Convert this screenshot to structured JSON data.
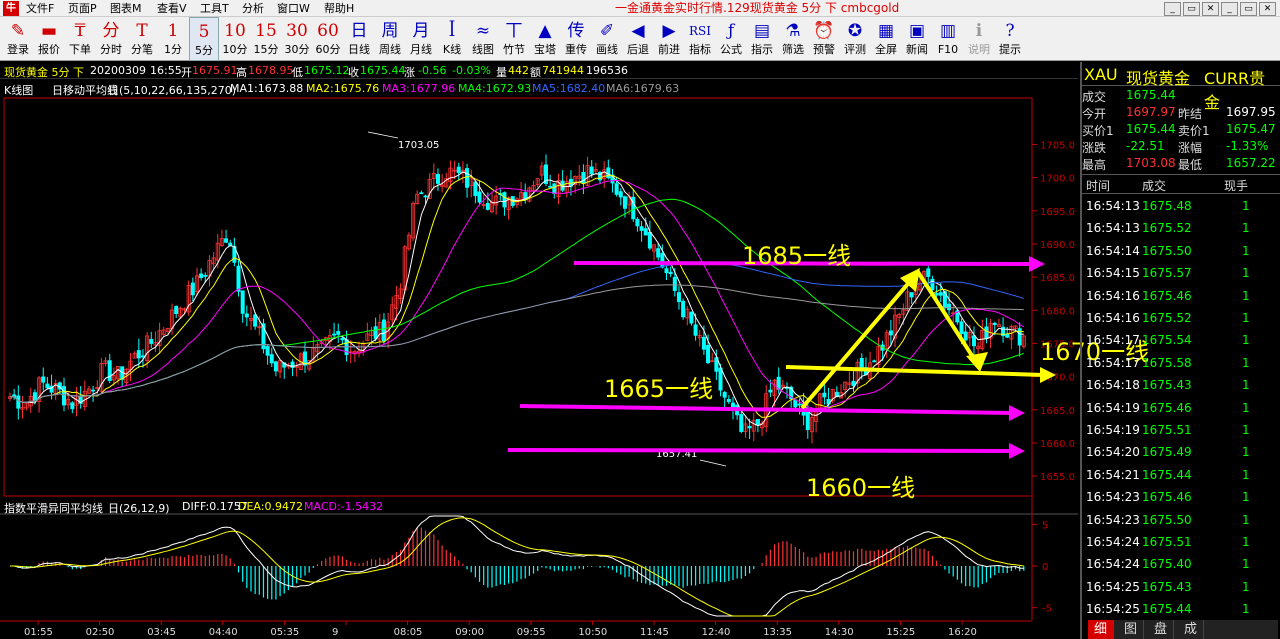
{
  "app": {
    "logo": "牛",
    "window_title": "一金通黄金实时行情.129现货黄金 5分 下 cmbcgold",
    "menus": [
      "文件F",
      "页面P",
      "图表M",
      "查看V",
      "工具T",
      "分析",
      "窗口W",
      "帮助H"
    ],
    "window_buttons": [
      "_",
      "▭",
      "✕",
      "_",
      "▭",
      "✕"
    ]
  },
  "toolbar": [
    {
      "glyph": "✎",
      "label": "登录",
      "color": "red"
    },
    {
      "glyph": "▬",
      "label": "报价",
      "color": "red"
    },
    {
      "glyph": "₸",
      "label": "下单",
      "color": "red"
    },
    {
      "glyph": "分",
      "label": "分时",
      "color": "red"
    },
    {
      "glyph": "T",
      "label": "分笔",
      "color": "red"
    },
    {
      "glyph": "1",
      "label": "1分",
      "color": "red"
    },
    {
      "glyph": "5",
      "label": "5分",
      "color": "red"
    },
    {
      "glyph": "10",
      "label": "10分",
      "color": "red"
    },
    {
      "glyph": "15",
      "label": "15分",
      "color": "red"
    },
    {
      "glyph": "30",
      "label": "30分",
      "color": "red"
    },
    {
      "glyph": "60",
      "label": "60分",
      "color": "red"
    },
    {
      "glyph": "日",
      "label": "日线",
      "color": "blue"
    },
    {
      "glyph": "周",
      "label": "周线",
      "color": "blue"
    },
    {
      "glyph": "月",
      "label": "月线",
      "color": "blue"
    },
    {
      "glyph": "ꟾ",
      "label": "K线",
      "color": "blue"
    },
    {
      "glyph": "≈",
      "label": "线图",
      "color": "blue"
    },
    {
      "glyph": "丅",
      "label": "竹节",
      "color": "blue"
    },
    {
      "glyph": "▲",
      "label": "宝塔",
      "color": "blue"
    },
    {
      "glyph": "传",
      "label": "重传",
      "color": "blue"
    },
    {
      "glyph": "✐",
      "label": "画线",
      "color": "blue"
    },
    {
      "glyph": "◀",
      "label": "后退",
      "color": "blue"
    },
    {
      "glyph": "▶",
      "label": "前进",
      "color": "blue"
    },
    {
      "glyph": "RSI",
      "label": "指标",
      "color": "blue"
    },
    {
      "glyph": "ƒ",
      "label": "公式",
      "color": "blue"
    },
    {
      "glyph": "▤",
      "label": "指示",
      "color": "blue"
    },
    {
      "glyph": "⚗",
      "label": "筛选",
      "color": "blue"
    },
    {
      "glyph": "⏰",
      "label": "预警",
      "color": "blue"
    },
    {
      "glyph": "✪",
      "label": "评测",
      "color": "blue"
    },
    {
      "glyph": "▦",
      "label": "全屏",
      "color": "blue"
    },
    {
      "glyph": "▣",
      "label": "新闻",
      "color": "blue"
    },
    {
      "glyph": "▥",
      "label": "F10",
      "color": "blue"
    },
    {
      "glyph": "ℹ",
      "label": "说明",
      "color": "grey"
    },
    {
      "glyph": "?",
      "label": "提示",
      "color": "blue"
    }
  ],
  "toolbar_selected": 6,
  "info": {
    "name": "现货黄金 5分 下",
    "date": "20200309",
    "time": "16:55",
    "open_label": "开",
    "open": "1675.91",
    "high_label": "高",
    "high": "1678.95",
    "low_label": "低",
    "low": "1675.12",
    "close_label": "收",
    "close": "1675.44",
    "chg_label": "涨",
    "chg": "-0.56",
    "chg_pct": "-0.03%",
    "vol_label": "量",
    "vol": "442",
    "amt_label": "额",
    "amt": "741944",
    "extra": "196536"
  },
  "ma": {
    "title": "K线图",
    "ind": "日移动平均线",
    "params": "日(5,10,22,66,135,270)",
    "lines": [
      {
        "label": "MA1:1673.88",
        "color": "#ffffff"
      },
      {
        "label": "MA2:1675.76",
        "color": "#ffff00"
      },
      {
        "label": "MA3:1677.96",
        "color": "#ff00ff"
      },
      {
        "label": "MA4:1672.93",
        "color": "#00ff00"
      },
      {
        "label": "MA5:1682.40",
        "color": "#3366ff"
      },
      {
        "label": "MA6:1679.63",
        "color": "#999999"
      }
    ]
  },
  "macd": {
    "name": "指数平滑异同平均线",
    "params": "日(26,12,9)",
    "diff": "DIFF:0.1757",
    "dea": "DEA:0.9472",
    "macd": "MACD:-1.5432"
  },
  "annotations": {
    "l1685": "1685一线",
    "l1670": "1670一线",
    "l1665": "1665一线",
    "l1660": "1660一线",
    "high_tag": "1703.05",
    "low_tag": "1657.41"
  },
  "time_axis": [
    "01:55",
    "02:50",
    "03:45",
    "04:40",
    "05:35",
    "9",
    "08:05",
    "09:00",
    "09:55",
    "10:50",
    "11:45",
    "12:40",
    "13:35",
    "14:30",
    "15:25",
    "16:20"
  ],
  "colors": {
    "up": "#ff3232",
    "down": "#00ffff",
    "axis": "#c00000",
    "magenta": "#ff00ff",
    "yellow": "#ffff00"
  },
  "chart_data": [
    {
      "type": "candlestick",
      "ylim": [
        1652,
        1712
      ],
      "yticks": [
        "1705.0",
        "1700.0",
        "1695.0",
        "1690.0",
        "1685.0",
        "1680.0",
        "1675.0",
        "1670.0",
        "1665.0",
        "1660.0",
        "1655.0"
      ],
      "close_path": [
        1667,
        1666,
        1669,
        1668,
        1666,
        1668,
        1671,
        1670,
        1673,
        1675,
        1678,
        1681,
        1684,
        1688,
        1692,
        1680,
        1676,
        1671,
        1672,
        1673,
        1674,
        1676,
        1674,
        1676,
        1677,
        1684,
        1697,
        1699,
        1701,
        1700,
        1698,
        1696,
        1697,
        1698,
        1701,
        1699,
        1700,
        1701,
        1700,
        1698,
        1695,
        1691,
        1686,
        1681,
        1676,
        1671,
        1666,
        1661,
        1663,
        1669,
        1667,
        1663,
        1666,
        1668,
        1670,
        1672,
        1675,
        1679,
        1684,
        1685,
        1681,
        1678,
        1674,
        1679,
        1677,
        1676
      ],
      "ma_params": [
        5,
        10,
        22,
        66,
        135,
        270
      ]
    },
    {
      "type": "macd",
      "ylim": [
        -6,
        6
      ],
      "yticks": [
        "5",
        "0",
        "-5"
      ]
    }
  ],
  "quote": {
    "hdr": [
      "XAU",
      "现货黄金",
      "CURR贵金"
    ],
    "rows": [
      {
        "l1": "成交",
        "v1": "1675.44",
        "c1": "#00ff00"
      },
      {
        "l1": "今开",
        "v1": "1697.97",
        "c1": "#ff3232",
        "l2": "昨结",
        "v2": "1697.95",
        "c2": "#ffffff"
      },
      {
        "l1": "买价1",
        "v1": "1675.44",
        "c1": "#00ff00",
        "l2": "卖价1",
        "v2": "1675.47",
        "c2": "#00ff00"
      },
      {
        "l1": "涨跌",
        "v1": "-22.51",
        "c1": "#00ff00",
        "l2": "涨幅",
        "v2": "-1.33%",
        "c2": "#00ff00"
      },
      {
        "l1": "最高",
        "v1": "1703.08",
        "c1": "#ff3232",
        "l2": "最低",
        "v2": "1657.22",
        "c2": "#00ff00"
      }
    ]
  },
  "ticks_header": [
    "时间",
    "成交",
    "现手"
  ],
  "ticks": [
    {
      "t": "16:54:13",
      "p": "1675.48",
      "v": "1"
    },
    {
      "t": "16:54:13",
      "p": "1675.52",
      "v": "1"
    },
    {
      "t": "16:54:14",
      "p": "1675.50",
      "v": "1"
    },
    {
      "t": "16:54:15",
      "p": "1675.57",
      "v": "1"
    },
    {
      "t": "16:54:16",
      "p": "1675.46",
      "v": "1"
    },
    {
      "t": "16:54:16",
      "p": "1675.52",
      "v": "1"
    },
    {
      "t": "16:54:17",
      "p": "1675.54",
      "v": "1"
    },
    {
      "t": "16:54:17",
      "p": "1675.58",
      "v": "1"
    },
    {
      "t": "16:54:18",
      "p": "1675.43",
      "v": "1"
    },
    {
      "t": "16:54:19",
      "p": "1675.46",
      "v": "1"
    },
    {
      "t": "16:54:19",
      "p": "1675.51",
      "v": "1"
    },
    {
      "t": "16:54:20",
      "p": "1675.49",
      "v": "1"
    },
    {
      "t": "16:54:21",
      "p": "1675.44",
      "v": "1"
    },
    {
      "t": "16:54:23",
      "p": "1675.46",
      "v": "1"
    },
    {
      "t": "16:54:23",
      "p": "1675.50",
      "v": "1"
    },
    {
      "t": "16:54:24",
      "p": "1675.51",
      "v": "1"
    },
    {
      "t": "16:54:24",
      "p": "1675.40",
      "v": "1"
    },
    {
      "t": "16:54:25",
      "p": "1675.43",
      "v": "1"
    },
    {
      "t": "16:54:25",
      "p": "1675.44",
      "v": "1"
    }
  ],
  "right_tabs": [
    "细",
    "图",
    "盘",
    "成"
  ]
}
